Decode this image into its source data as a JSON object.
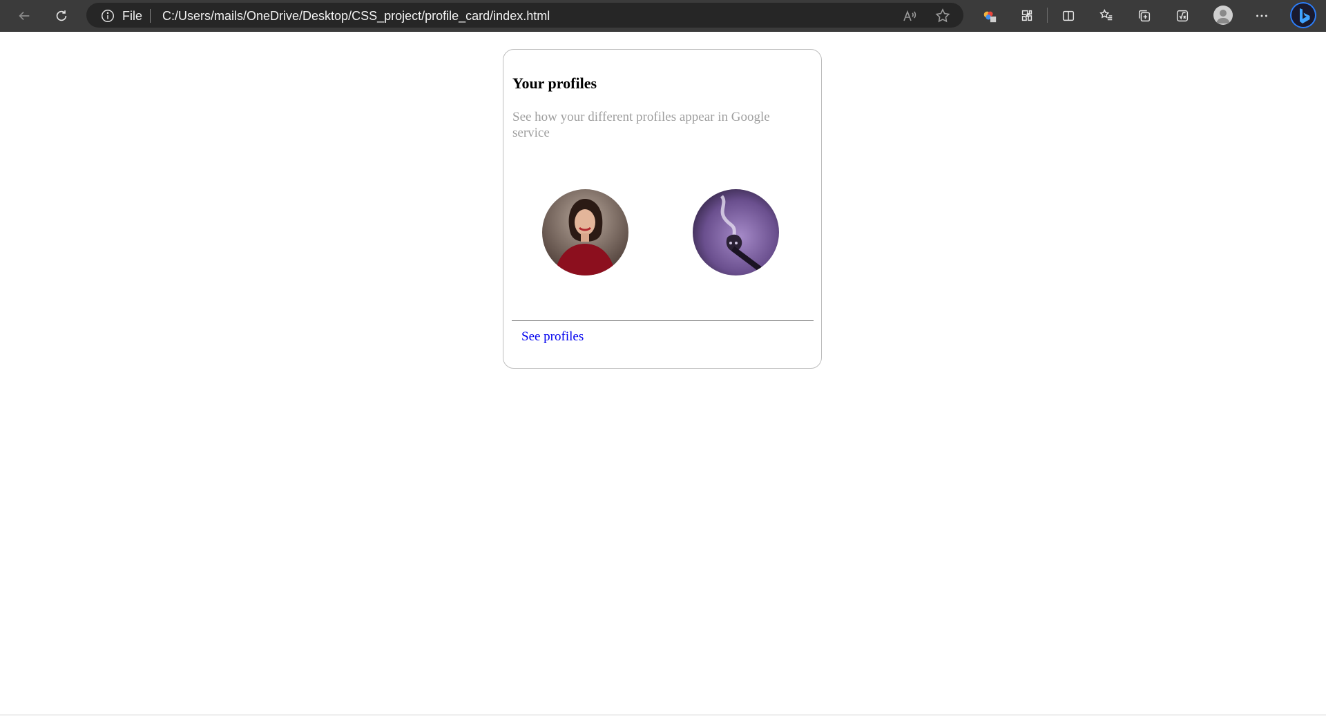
{
  "browser": {
    "address_scheme": "File",
    "address_url": "C:/Users/mails/OneDrive/Desktop/CSS_project/profile_card/index.html"
  },
  "card": {
    "title": "Your profiles",
    "subtitle": "See how your different profiles appear in Google service",
    "link_label": "See profiles"
  }
}
